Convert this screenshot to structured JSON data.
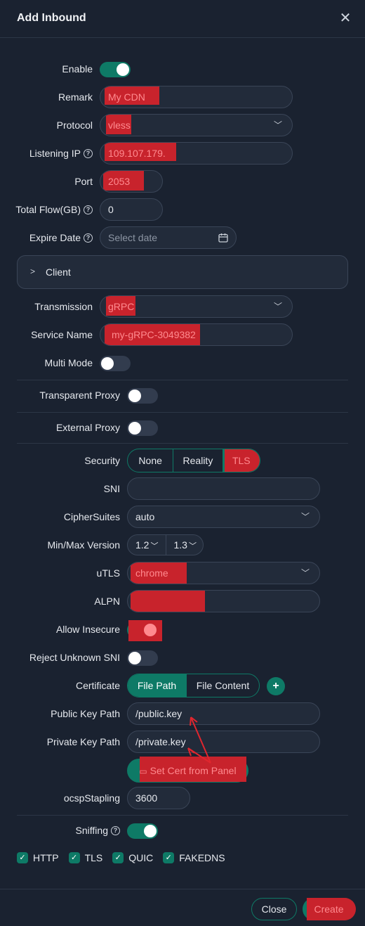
{
  "header": {
    "title": "Add Inbound",
    "close_icon": "✕"
  },
  "form": {
    "enable": {
      "label": "Enable",
      "on": true
    },
    "remark": {
      "label": "Remark",
      "value": "My CDN"
    },
    "protocol": {
      "label": "Protocol",
      "value": "vless"
    },
    "listening_ip": {
      "label": "Listening IP",
      "value": "109.107.179."
    },
    "port": {
      "label": "Port",
      "value": "2053"
    },
    "total_flow": {
      "label": "Total Flow(GB)",
      "value": "0"
    },
    "expire_date": {
      "label": "Expire Date",
      "placeholder": "Select date"
    },
    "client": {
      "label": "Client"
    },
    "transmission": {
      "label": "Transmission",
      "value": "gRPC"
    },
    "service_name": {
      "label": "Service Name",
      "value": "my-gRPC-3049382"
    },
    "multi_mode": {
      "label": "Multi Mode",
      "on": false
    },
    "transparent_proxy": {
      "label": "Transparent Proxy",
      "on": false
    },
    "external_proxy": {
      "label": "External Proxy",
      "on": false
    },
    "security": {
      "label": "Security",
      "options": [
        "None",
        "Reality",
        "TLS"
      ],
      "selected": "TLS"
    },
    "sni": {
      "label": "SNI",
      "value": ""
    },
    "cipher_suites": {
      "label": "CipherSuites",
      "value": "auto"
    },
    "min_max_version": {
      "label": "Min/Max Version",
      "min": "1.2",
      "max": "1.3"
    },
    "utls": {
      "label": "uTLS",
      "value": "chrome"
    },
    "alpn": {
      "label": "ALPN",
      "value": ""
    },
    "allow_insecure": {
      "label": "Allow Insecure",
      "on": true
    },
    "reject_unknown_sni": {
      "label": "Reject Unknown SNI",
      "on": false
    },
    "certificate": {
      "label": "Certificate",
      "options": [
        "File Path",
        "File Content"
      ],
      "selected": "File Path"
    },
    "public_key_path": {
      "label": "Public Key Path",
      "value": "/public.key"
    },
    "private_key_path": {
      "label": "Private Key Path",
      "value": "/private.key"
    },
    "set_cert_button": "Set Cert from Panel",
    "ocsp_stapling": {
      "label": "ocspStapling",
      "value": "3600"
    },
    "sniffing": {
      "label": "Sniffing",
      "on": true,
      "options": [
        "HTTP",
        "TLS",
        "QUIC",
        "FAKEDNS"
      ]
    }
  },
  "footer": {
    "close_label": "Close",
    "create_label": "Create"
  },
  "colors": {
    "accent": "#0e7a66",
    "background": "#1a2230",
    "redaction": "#c8232c"
  }
}
